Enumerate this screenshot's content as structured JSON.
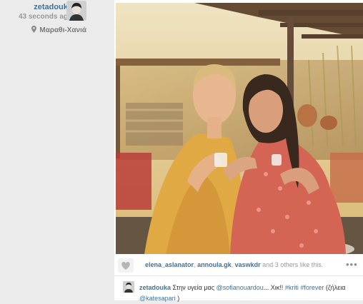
{
  "post": {
    "username": "zetadouka",
    "timestamp": "43 seconds ago",
    "location": "Μαραθι-Χανιά"
  },
  "likes": {
    "users": [
      "elena_aslanator",
      "annoula.gk",
      "vaswkdr"
    ],
    "separator": ",",
    "others_text": "and 3 others like this."
  },
  "caption": {
    "username": "zetadouka",
    "text_before": "Στην υγεία μας",
    "mention_1": "@sofianouardou",
    "text_middle": "... Χικ!!",
    "tag_1": "#kriti",
    "tag_2": "#forever",
    "text_after": "(ζήλεια",
    "mention_2": "@katesapari",
    "text_end": ")"
  },
  "icons": {
    "location": "map-pin-icon",
    "like": "heart-icon",
    "more": "more-dots-icon"
  },
  "colors": {
    "link_blue": "#3f729b",
    "secondary_text": "#999999",
    "page_bg": "#ebebeb"
  }
}
